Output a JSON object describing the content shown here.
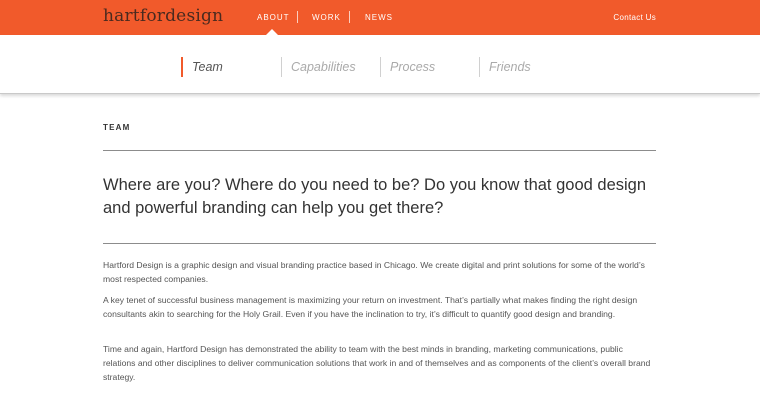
{
  "header": {
    "logo": "hartfordesign",
    "nav": [
      {
        "label": "ABOUT",
        "active": true
      },
      {
        "label": "WORK",
        "active": false
      },
      {
        "label": "NEWS",
        "active": false
      }
    ],
    "contact": "Contact Us",
    "accent_color": "#f15a2b"
  },
  "subnav": {
    "tabs": [
      {
        "label": "Team",
        "active": true
      },
      {
        "label": "Capabilities",
        "active": false
      },
      {
        "label": "Process",
        "active": false
      },
      {
        "label": "Friends",
        "active": false
      }
    ]
  },
  "main": {
    "section_label": "TEAM",
    "headline": "Where are you? Where do you need to be? Do you know that good design and powerful branding can help you get there?",
    "paragraphs": [
      "Hartford Design is a graphic design and visual branding practice based in Chicago. We create digital and print solutions for some of the world’s most respected companies.",
      "A key tenet of successful business management is maximizing your return on investment. That’s partially what makes finding the right design consultants akin to searching for the Holy Grail. Even if you have the inclination to try, it’s difficult to quantify good design and branding.",
      "Time and again, Hartford Design has demonstrated the ability to team with the best minds in branding, marketing communications, public relations and other disciplines to deliver communication solutions that work in and of themselves and as components of the client’s overall brand strategy."
    ]
  }
}
